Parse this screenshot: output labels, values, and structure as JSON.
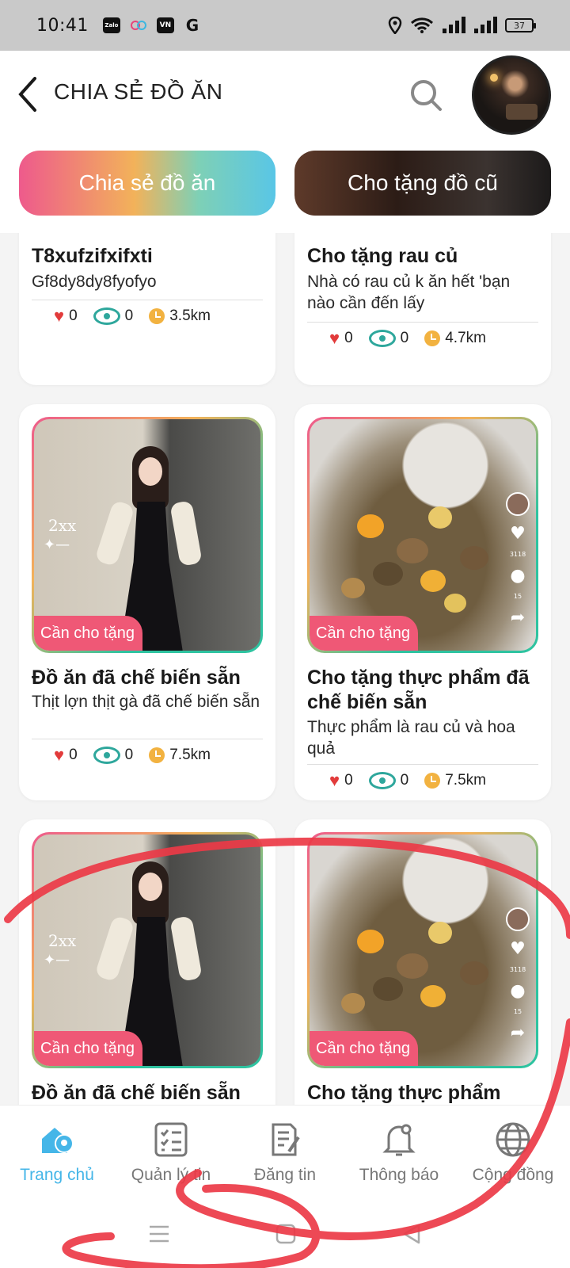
{
  "status_bar": {
    "time": "10:41",
    "apps": [
      "Zalo",
      "",
      "VN",
      "G"
    ],
    "battery": "37"
  },
  "header": {
    "title": "CHIA SẺ ĐỒ ĂN"
  },
  "tabs": [
    {
      "label": "Chia sẻ đồ ăn",
      "active": true
    },
    {
      "label": "Cho tặng đồ cũ",
      "active": false
    }
  ],
  "posts": [
    {
      "title": "T8xufzifxifxti",
      "description": "Gf8dy8dy8fyofyo",
      "likes": "0",
      "views": "0",
      "distance": "3.5km"
    },
    {
      "title": "Cho tặng rau củ",
      "description": "Nhà có rau củ k ăn hết 'bạn nào cần đến lấy",
      "likes": "0",
      "views": "0",
      "distance": "4.7km"
    },
    {
      "badge": "Cần cho tặng",
      "title": "Đồ ăn đã chế biến sẵn",
      "description": "Thịt lợn thịt gà đã chế biến sẵn",
      "likes": "0",
      "views": "0",
      "distance": "7.5km",
      "watermark": "2xx",
      "side_likes": "3118",
      "side_comments": "15"
    },
    {
      "badge": "Cần cho tặng",
      "title": "Cho tặng thực phẩm đã chế biến sẵn",
      "description": "Thực phẩm là rau củ và hoa quả",
      "likes": "0",
      "views": "0",
      "distance": "7.5km",
      "side_likes": "3118",
      "side_comments": "15"
    },
    {
      "badge": "Cần cho tặng",
      "title": "Đồ ăn đã chế biến sẵn",
      "watermark": "2xx"
    },
    {
      "badge": "Cần cho tặng",
      "title": "Cho tặng thực phẩm",
      "side_likes": "3118",
      "side_comments": "15"
    }
  ],
  "bottom_nav": [
    {
      "label": "Trang chủ",
      "icon": "home-location-icon",
      "active": true
    },
    {
      "label": "Quản lý tin",
      "icon": "checklist-icon",
      "active": false
    },
    {
      "label": "Đăng tin",
      "icon": "edit-document-icon",
      "active": false
    },
    {
      "label": "Thông báo",
      "icon": "bell-icon",
      "active": false
    },
    {
      "label": "Cộng đồng",
      "icon": "globe-icon",
      "active": false
    }
  ],
  "colors": {
    "accent": "#45b6e8",
    "badge": "#ef5876",
    "heart": "#e23b3b",
    "eye": "#2ea79c",
    "clock": "#f2b240",
    "annotation": "#ec3a47"
  }
}
